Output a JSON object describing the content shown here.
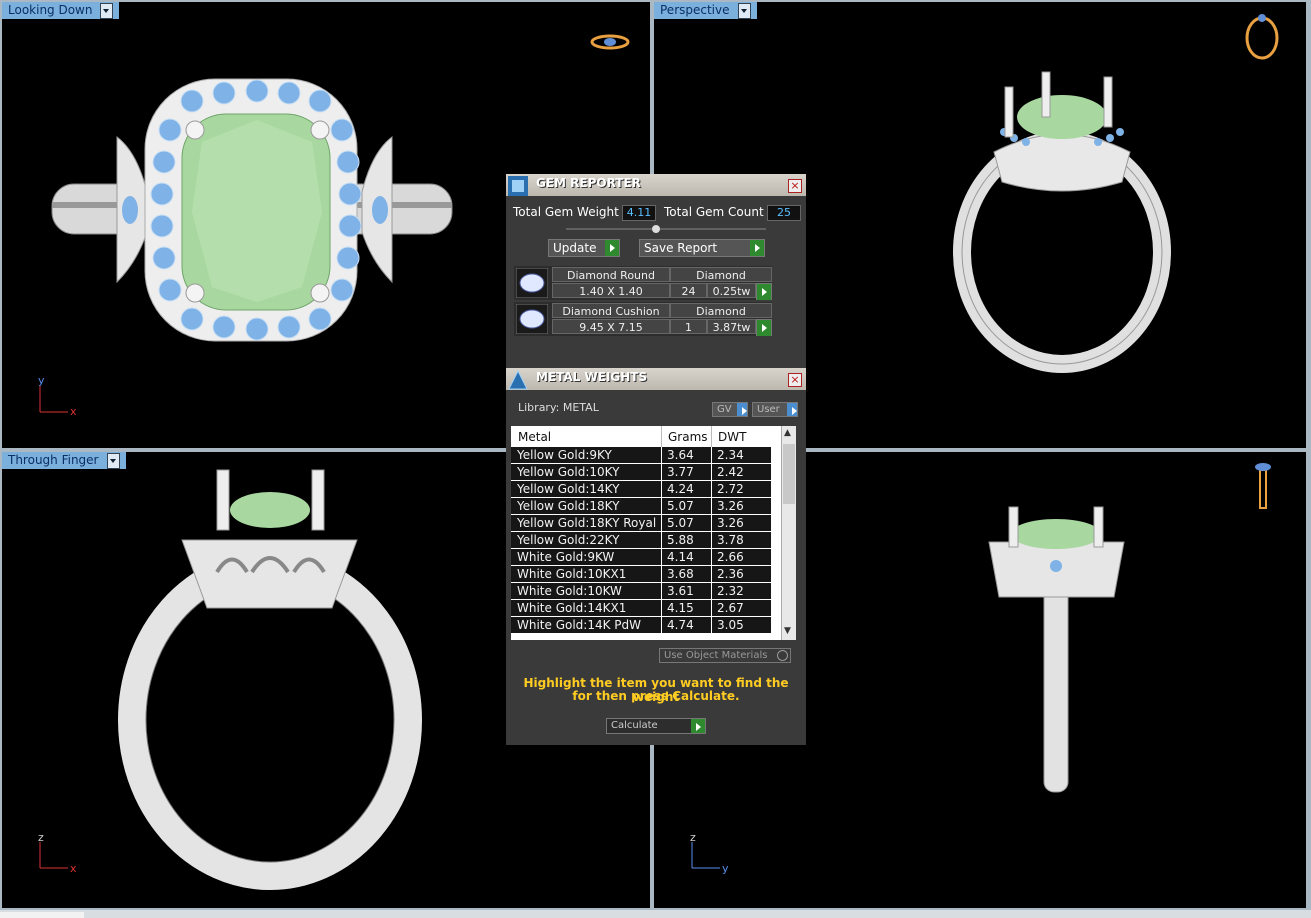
{
  "viewports": {
    "top_left": {
      "label": "Looking Down"
    },
    "top_right": {
      "label": "Perspective"
    },
    "bottom_left": {
      "label": "Through Finger"
    },
    "bottom_right": {
      "label": ""
    }
  },
  "axes": {
    "top_left": {
      "v": "y",
      "h": "x"
    },
    "bottom_left": {
      "v": "z",
      "h": "x"
    },
    "bottom_right": {
      "v": "z",
      "h": "y"
    }
  },
  "colors": {
    "gem_green": "#a8d8a0",
    "accent_stone": "#7fb2e6",
    "metal_white": "#e4e4e4",
    "label_bg": "#7bb0dc"
  },
  "gem_reporter": {
    "title": "GEM REPORTER",
    "total_weight_label": "Total Gem Weight",
    "total_weight": "4.11",
    "total_count_label": "Total Gem Count",
    "total_count": "25",
    "update_label": "Update",
    "save_report_label": "Save Report",
    "gems": [
      {
        "name": "Diamond Round",
        "material": "Diamond",
        "size": "1.40 X 1.40",
        "count": "24",
        "weight": "0.25tw"
      },
      {
        "name": "Diamond Cushion",
        "material": "Diamond",
        "size": "9.45 X 7.15",
        "count": "1",
        "weight": "3.87tw"
      }
    ]
  },
  "metal_weights": {
    "title": "METAL WEIGHTS",
    "library_label": "Library: METAL",
    "gv_label": "GV",
    "user_label": "User",
    "columns": [
      "Metal",
      "Grams",
      "DWT"
    ],
    "rows": [
      {
        "metal": "Yellow Gold:9KY",
        "grams": "3.64",
        "dwt": "2.34"
      },
      {
        "metal": "Yellow Gold:10KY",
        "grams": "3.77",
        "dwt": "2.42"
      },
      {
        "metal": "Yellow Gold:14KY",
        "grams": "4.24",
        "dwt": "2.72"
      },
      {
        "metal": "Yellow Gold:18KY",
        "grams": "5.07",
        "dwt": "3.26"
      },
      {
        "metal": "Yellow Gold:18KY Royal",
        "grams": "5.07",
        "dwt": "3.26"
      },
      {
        "metal": "Yellow Gold:22KY",
        "grams": "5.88",
        "dwt": "3.78"
      },
      {
        "metal": "White Gold:9KW",
        "grams": "4.14",
        "dwt": "2.66"
      },
      {
        "metal": "White Gold:10KX1",
        "grams": "3.68",
        "dwt": "2.36"
      },
      {
        "metal": "White Gold:10KW",
        "grams": "3.61",
        "dwt": "2.32"
      },
      {
        "metal": "White Gold:14KX1",
        "grams": "4.15",
        "dwt": "2.67"
      },
      {
        "metal": "White Gold:14K PdW",
        "grams": "4.74",
        "dwt": "3.05"
      }
    ],
    "use_object_materials_label": "Use Object Materials",
    "hint_line1": "Highlight the item you want to find the weight",
    "hint_line2": "for then press Calculate.",
    "calculate_label": "Calculate"
  }
}
